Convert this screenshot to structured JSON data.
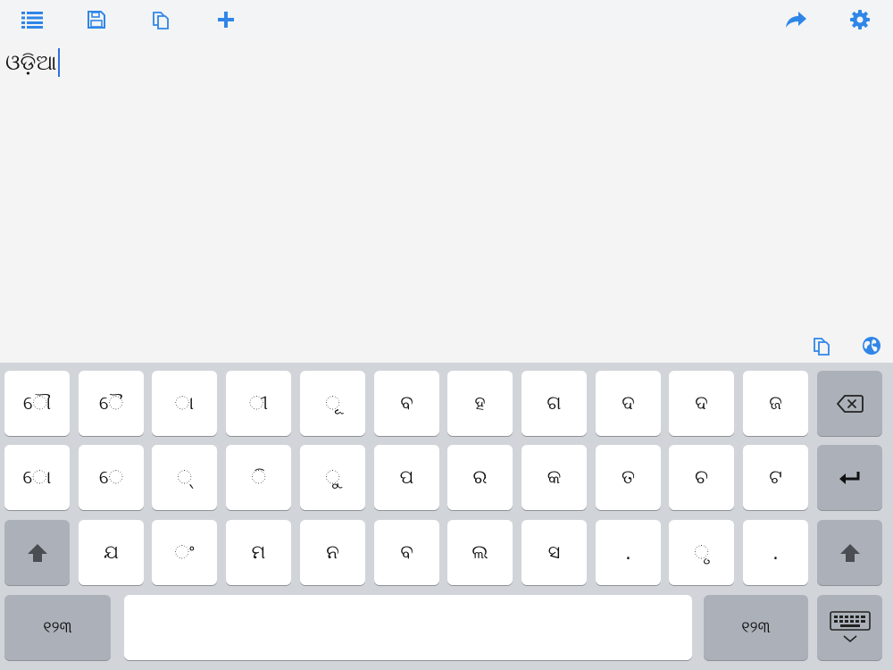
{
  "toolbar": {
    "icons": [
      "list-icon",
      "save-icon",
      "copy-icon",
      "plus-icon",
      "share-icon",
      "gear-icon"
    ],
    "accent": "#2f86e8"
  },
  "editor": {
    "text": "ଓଡ଼ିଆ"
  },
  "accessory": {
    "icons": [
      "copy-icon",
      "globe-icon"
    ]
  },
  "keyboard": {
    "row1": [
      "ୌ",
      "ୈ",
      "ା",
      "ୀ",
      "ୂ",
      "ବ",
      "ହ",
      "ଗ",
      "ଦ",
      "ଦ",
      "ଜ"
    ],
    "row2": [
      "ୋ",
      "େ",
      "୍",
      "ି",
      "ୁ",
      "ପ",
      "ର",
      "କ",
      "ତ",
      "ଚ",
      "ଟ"
    ],
    "row3": [
      "ଯ",
      "ଂ",
      "ମ",
      "ନ",
      "ବ",
      "ଲ",
      "ସ",
      ".",
      "ୃ",
      "."
    ],
    "numbers_label": "୧୨୩",
    "special_icons": [
      "backspace-icon",
      "return-icon",
      "shift-icon",
      "keyboard-dismiss-icon"
    ]
  }
}
